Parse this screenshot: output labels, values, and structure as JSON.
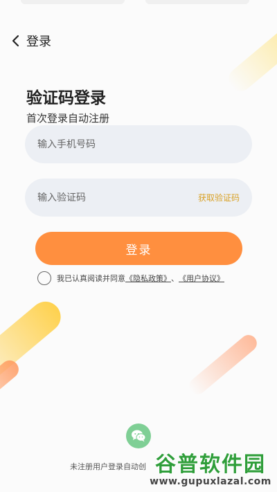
{
  "header": {
    "title": "登录"
  },
  "main": {
    "title": "验证码登录",
    "subtitle": "首次登录自动注册",
    "phone_placeholder": "输入手机号码",
    "code_placeholder": "输入验证码",
    "get_code_label": "获取验证码",
    "login_button": "登录"
  },
  "agreement": {
    "prefix": "我已认真阅读并同意",
    "privacy_link": "《隐私政策》",
    "separator": "、",
    "user_link": "《用户协议》"
  },
  "footer": {
    "note": "未注册用户登录自动创",
    "wechat_icon": "wechat-icon"
  },
  "watermark": {
    "name": "谷普软件园",
    "url": "www.gupuxlazal.com"
  },
  "colors": {
    "primary": "#ff8f3f",
    "accent_text": "#d9a125",
    "field_bg": "#eceff4",
    "wechat": "#7fcf95"
  }
}
